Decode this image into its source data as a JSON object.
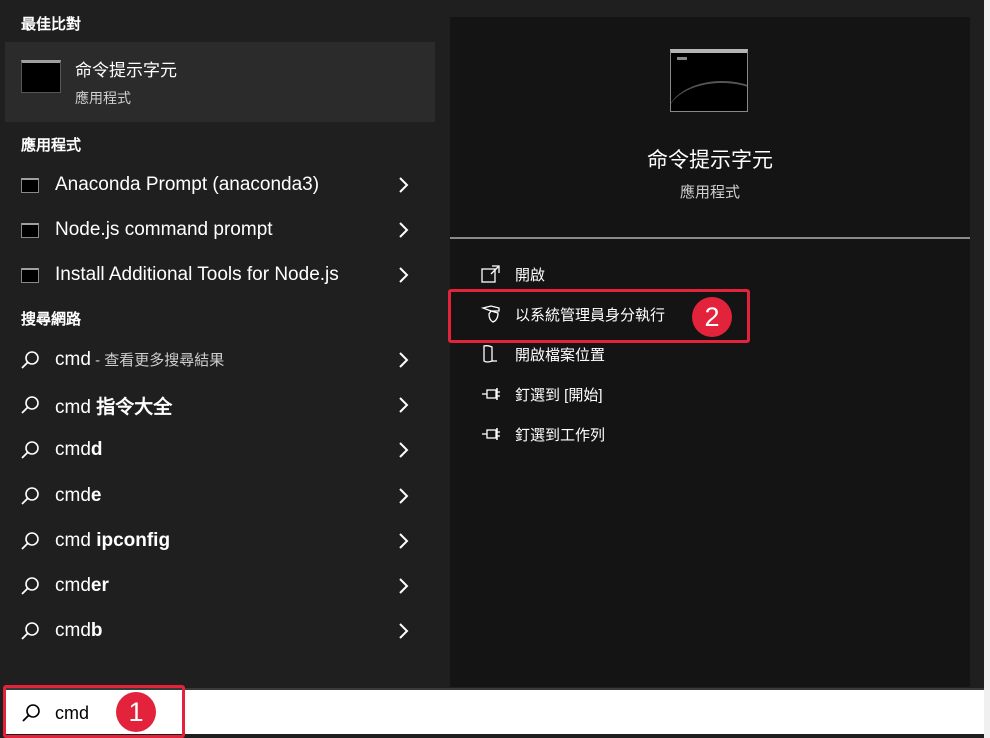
{
  "best_match": {
    "section_title": "最佳比對",
    "name": "命令提示字元",
    "type": "應用程式"
  },
  "apps": {
    "section_title": "應用程式",
    "items": [
      {
        "label": "Anaconda Prompt (anaconda3)"
      },
      {
        "label": "Node.js command prompt"
      },
      {
        "label": "Install Additional Tools for Node.js"
      }
    ]
  },
  "web": {
    "section_title": "搜尋網路",
    "items": [
      {
        "prefix": "cmd",
        "suffix": " - 查看更多搜尋結果",
        "style": "dim"
      },
      {
        "prefix": "cmd ",
        "suffix": "指令大全",
        "style": "bold"
      },
      {
        "prefix": "cmd",
        "suffix": "d",
        "style": "bold"
      },
      {
        "prefix": "cmd",
        "suffix": "e",
        "style": "bold"
      },
      {
        "prefix": "cmd ",
        "suffix": "ipconfig",
        "style": "bold"
      },
      {
        "prefix": "cmd",
        "suffix": "er",
        "style": "bold"
      },
      {
        "prefix": "cmd",
        "suffix": "b",
        "style": "bold"
      }
    ]
  },
  "preview": {
    "title": "命令提示字元",
    "subtitle": "應用程式",
    "actions": [
      {
        "label": "開啟",
        "icon": "open-icon"
      },
      {
        "label": "以系統管理員身分執行",
        "icon": "shield-icon"
      },
      {
        "label": "開啟檔案位置",
        "icon": "folder-icon"
      },
      {
        "label": "釘選到 [開始]",
        "icon": "pin-icon"
      },
      {
        "label": "釘選到工作列",
        "icon": "pin-icon"
      }
    ]
  },
  "search": {
    "value": "cmd"
  },
  "annotations": {
    "badge1": "1",
    "badge2": "2",
    "color": "#e3233c"
  }
}
